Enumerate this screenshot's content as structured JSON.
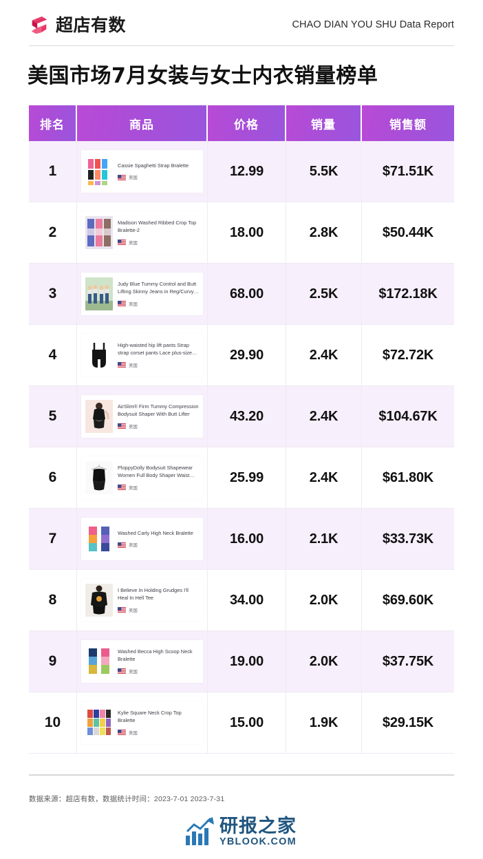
{
  "header": {
    "brand_name": "超店有数",
    "brand_mark_icon": "chaodian-ribbon-logo",
    "report_kicker": "CHAO DIAN YOU SHU Data Report"
  },
  "title": "美国市场7月女装与女士内衣销量榜单",
  "table": {
    "columns": [
      "排名",
      "商品",
      "价格",
      "销量",
      "销售额"
    ],
    "rows": [
      {
        "rank": "1",
        "product": "Cassie Spaghetti Strap Bralette",
        "country": "美国",
        "country_flag": "us-flag-icon",
        "price": "12.99",
        "volume": "5.5K",
        "amount": "$71.51K",
        "thumb": "bralette-color-grid"
      },
      {
        "rank": "2",
        "product": "Madison Washed Ribbed Crop Top Bralette-2",
        "country": "美国",
        "country_flag": "us-flag-icon",
        "price": "18.00",
        "volume": "2.8K",
        "amount": "$50.44K",
        "thumb": "crop-top-swatches"
      },
      {
        "rank": "3",
        "product": "Judy Blue Tummy Control and Butt Lifting Skinny Jeans in Reg/Curvy The…",
        "country": "美国",
        "country_flag": "us-flag-icon",
        "price": "68.00",
        "volume": "2.5K",
        "amount": "$172.18K",
        "thumb": "jeans-models-photo"
      },
      {
        "rank": "4",
        "product": "High-waisted hip lift pants Strap strap corset pants Lace plus-size tummy tuc…",
        "country": "美国",
        "country_flag": "us-flag-icon",
        "price": "29.90",
        "volume": "2.4K",
        "amount": "$72.72K",
        "thumb": "black-bodysuit-shaper"
      },
      {
        "rank": "5",
        "product": "AirSlim® Firm Tummy Compression Bodysuit Shaper With Butt Lifter",
        "country": "美国",
        "country_flag": "us-flag-icon",
        "price": "43.20",
        "volume": "2.4K",
        "amount": "$104.67K",
        "thumb": "model-wearing-shaper"
      },
      {
        "rank": "6",
        "product": "PloppyDolly Bodysuit Shapewear Women Full Body Shaper Waist Trainer…",
        "country": "美国",
        "country_flag": "us-flag-icon",
        "price": "25.99",
        "volume": "2.4K",
        "amount": "$61.80K",
        "thumb": "black-bodysuit-hanger"
      },
      {
        "rank": "7",
        "product": "Washed Carly High Neck Bralette",
        "country": "美国",
        "country_flag": "us-flag-icon",
        "price": "16.00",
        "volume": "2.1K",
        "amount": "$33.73K",
        "thumb": "two-bralettes-pair"
      },
      {
        "rank": "8",
        "product": "I Believe In Holding Grudges I'll Heal In Hell Tee",
        "country": "美国",
        "country_flag": "us-flag-icon",
        "price": "34.00",
        "volume": "2.0K",
        "amount": "$69.60K",
        "thumb": "black-graphic-tee-model"
      },
      {
        "rank": "9",
        "product": "Washed Becca High Scoop Neck Bralette",
        "country": "美国",
        "country_flag": "us-flag-icon",
        "price": "19.00",
        "volume": "2.0K",
        "amount": "$37.75K",
        "thumb": "two-bralettes-colors"
      },
      {
        "rank": "10",
        "product": "Kylie Square Neck Crop Top Bralette",
        "country": "美国",
        "country_flag": "us-flag-icon",
        "price": "15.00",
        "volume": "1.9K",
        "amount": "$29.15K",
        "thumb": "multi-color-crop-grid"
      }
    ]
  },
  "footer": {
    "source_note": "数据来源：超店有数，数据统计时间：2023-7-01 2023-7-31"
  },
  "watermark": {
    "cn": "研报之家",
    "en": "YBLOOK.COM",
    "icon": "bar-chart-arrow-icon"
  },
  "colors": {
    "header_gradient_start": "#b94ad6",
    "header_gradient_end": "#9a55dd",
    "row_odd_bg": "#f7effc",
    "brand_pink": "#e8386a",
    "watermark_blue": "#20567f"
  }
}
